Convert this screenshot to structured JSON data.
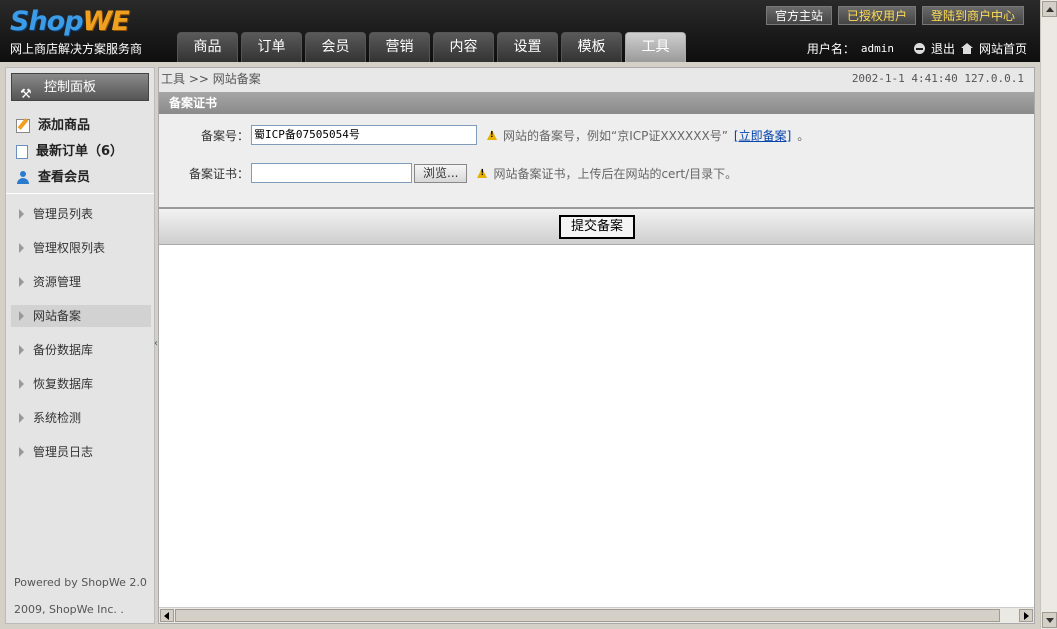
{
  "header": {
    "logo_part1": "Shop",
    "logo_part2": "WE",
    "slogan": "网上商店解决方案服务商",
    "top_buttons": [
      "官方主站",
      "已授权用户",
      "登陆到商户中心"
    ],
    "tabs": [
      "商品",
      "订单",
      "会员",
      "营销",
      "内容",
      "设置",
      "模板",
      "工具"
    ],
    "active_tab": "工具",
    "username_label": "用户名：",
    "username": "admin",
    "logout": "退出",
    "home": "网站首页"
  },
  "sidebar": {
    "panel_title": "控制面板",
    "quick_links": [
      "添加商品",
      "最新订单（6）",
      "查看会员"
    ],
    "menu": [
      "管理员列表",
      "管理权限列表",
      "资源管理",
      "网站备案",
      "备份数据库",
      "恢复数据库",
      "系统检测",
      "管理员日志"
    ],
    "active_menu": "网站备案",
    "footer1": "Powered by ShopWe 2.0",
    "footer2": "2009, ShopWe Inc. ."
  },
  "content": {
    "breadcrumb": "工具 >> 网站备案",
    "datetime": "2002-1-1 4:41:40 127.0.0.1",
    "section_title": "备案证书",
    "fields": {
      "icp_label": "备案号：",
      "icp_value": "蜀ICP备07505054号",
      "icp_hint": "网站的备案号，例如“京ICP证XXXXXX号”",
      "icp_link": "[立即备案]",
      "icp_hint_end": "。",
      "cert_label": "备案证书：",
      "cert_value": "",
      "browse_button": "浏览...",
      "cert_hint": "网站备案证书，上传后在网站的cert/目录下。"
    },
    "submit_button": "提交备案"
  }
}
